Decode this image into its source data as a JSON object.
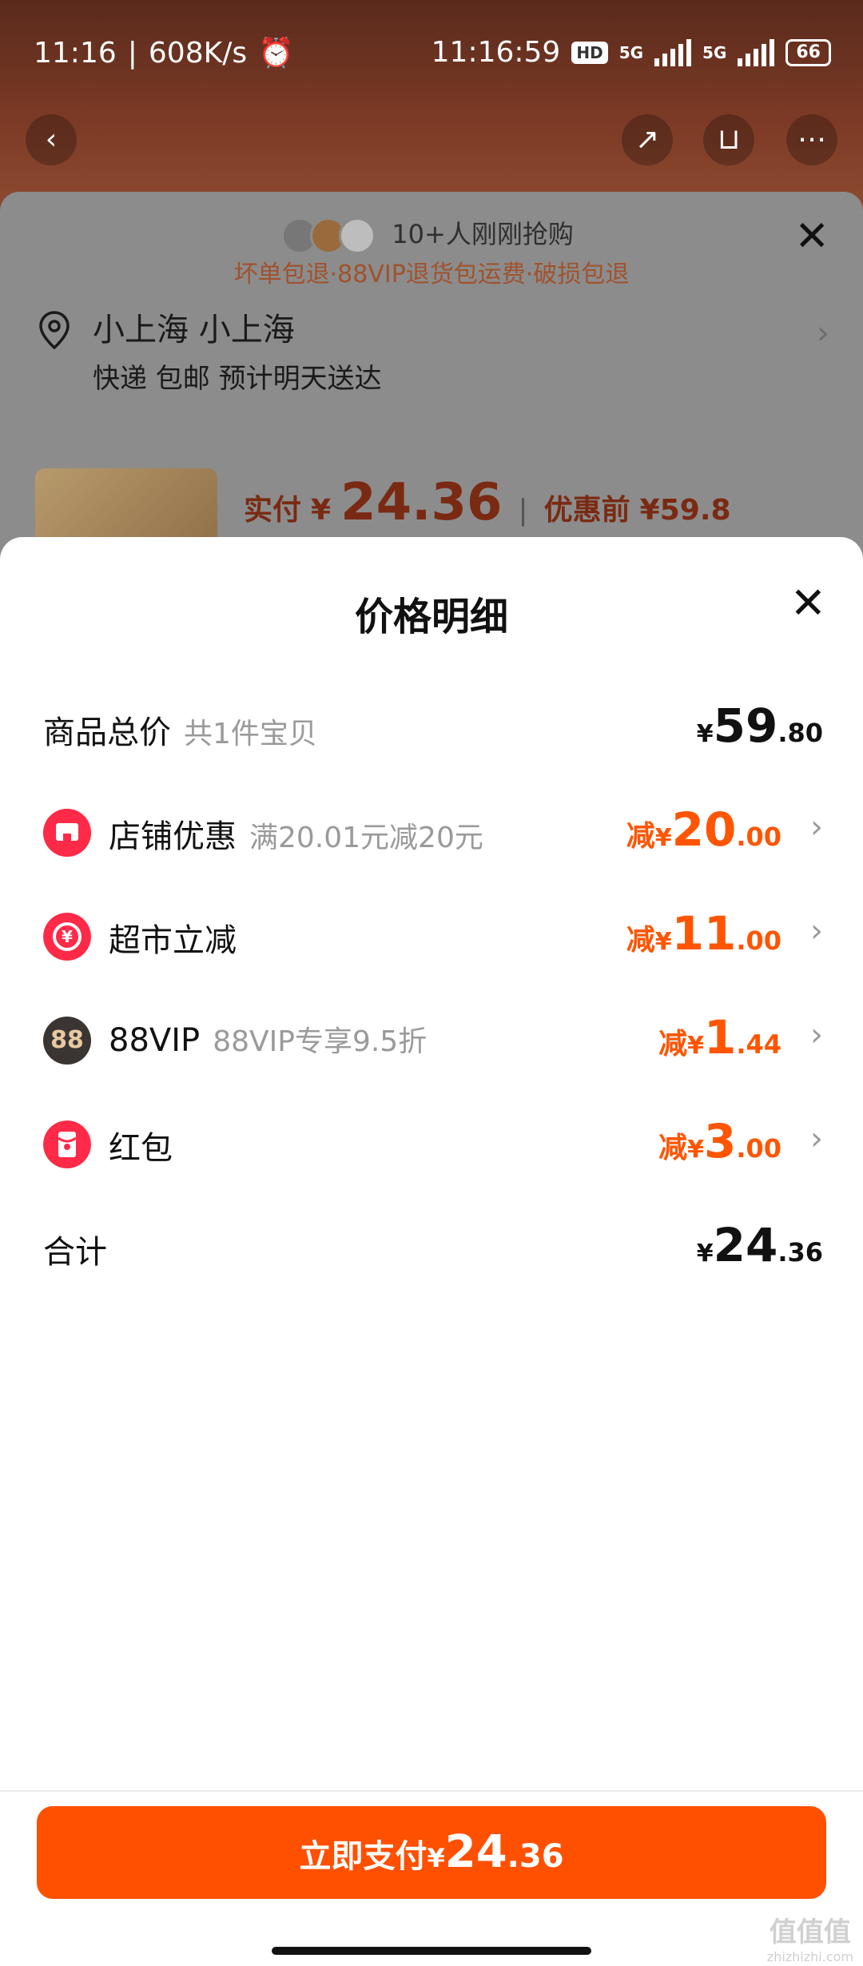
{
  "status_bar": {
    "time": "11:16",
    "speed": "608K/s",
    "clock": "11:16:59",
    "hd": "HD",
    "net1": "5G",
    "net2": "5G",
    "battery": "66"
  },
  "dimmed_sheet": {
    "buyers_text": "10+人刚刚抢购",
    "guarantee_text": "坏单包退·88VIP退货包运费·破损包退",
    "address_name": "小上海 小上海",
    "delivery_text": "快递 包邮 预计明天送达",
    "paid_label": "实付",
    "paid_currency": "¥",
    "paid_amount": "24.36",
    "before_label": "优惠前",
    "before_amount": "¥59.8"
  },
  "price_detail": {
    "title": "价格明细",
    "rows": [
      {
        "label": "商品总价",
        "desc": "共1件宝贝",
        "prefix": "",
        "currency": "¥",
        "int": "59",
        "dec": ".80"
      },
      {
        "label": "店铺优惠",
        "desc": "满20.01元减20元",
        "prefix": "减",
        "currency": "¥",
        "int": "20",
        "dec": ".00"
      },
      {
        "label": "超市立减",
        "desc": "",
        "prefix": "减",
        "currency": "¥",
        "int": "11",
        "dec": ".00"
      },
      {
        "label": "88VIP",
        "desc": "88VIP专享9.5折",
        "prefix": "减",
        "currency": "¥",
        "int": "1",
        "dec": ".44"
      },
      {
        "label": "红包",
        "desc": "",
        "prefix": "减",
        "currency": "¥",
        "int": "3",
        "dec": ".00"
      },
      {
        "label": "合计",
        "desc": "",
        "prefix": "",
        "currency": "¥",
        "int": "24",
        "dec": ".36"
      }
    ],
    "vip_icon_text": "88"
  },
  "pay_button": {
    "label": "立即支付",
    "currency": "¥",
    "int": "24",
    "dec": ".36"
  },
  "watermark": {
    "main": "值值值",
    "sub": "zhizhizhi.com"
  },
  "colors": {
    "accent": "#ff5000",
    "discount": "#ff5500",
    "icon_red": "#ff2a48"
  }
}
